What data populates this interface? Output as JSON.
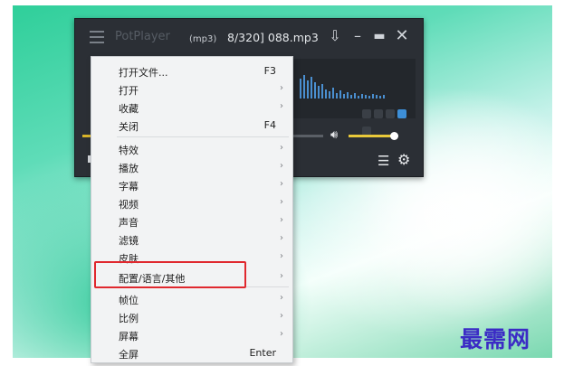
{
  "player": {
    "brand": "PotPlayer",
    "format": "(mp3)",
    "track": "8/320] 088.mp3",
    "volume_fraction": 0.9,
    "seek_fraction": 0.05
  },
  "controls": {
    "pin_icon": "pin-icon",
    "minimize_icon": "minimize-icon",
    "maximize_icon": "maximize-icon",
    "close_icon": "close-icon"
  },
  "menu": {
    "items": [
      {
        "label": "打开文件...",
        "shortcut": "F3",
        "submenu": false
      },
      {
        "label": "打开",
        "shortcut": "",
        "submenu": true
      },
      {
        "label": "收藏",
        "shortcut": "",
        "submenu": true
      },
      {
        "label": "关闭",
        "shortcut": "F4",
        "submenu": false
      },
      {
        "label": "特效",
        "shortcut": "",
        "submenu": true
      },
      {
        "label": "播放",
        "shortcut": "",
        "submenu": true
      },
      {
        "label": "字幕",
        "shortcut": "",
        "submenu": true
      },
      {
        "label": "视频",
        "shortcut": "",
        "submenu": true
      },
      {
        "label": "声音",
        "shortcut": "",
        "submenu": true
      },
      {
        "label": "滤镜",
        "shortcut": "",
        "submenu": true
      },
      {
        "label": "皮肤",
        "shortcut": "",
        "submenu": true
      },
      {
        "label": "配置/语言/其他",
        "shortcut": "",
        "submenu": true
      },
      {
        "label": "帧位",
        "shortcut": "",
        "submenu": true
      },
      {
        "label": "比例",
        "shortcut": "",
        "submenu": true
      },
      {
        "label": "屏幕",
        "shortcut": "",
        "submenu": true
      },
      {
        "label": "全屏",
        "shortcut": "Enter",
        "submenu": false
      }
    ],
    "highlighted_label": "配置/语言/其他"
  },
  "watermark": "最需网",
  "colors": {
    "accent_yellow": "#e9c93a",
    "highlight_red": "#e0282e",
    "watermark_blue": "#3b2bc5"
  }
}
